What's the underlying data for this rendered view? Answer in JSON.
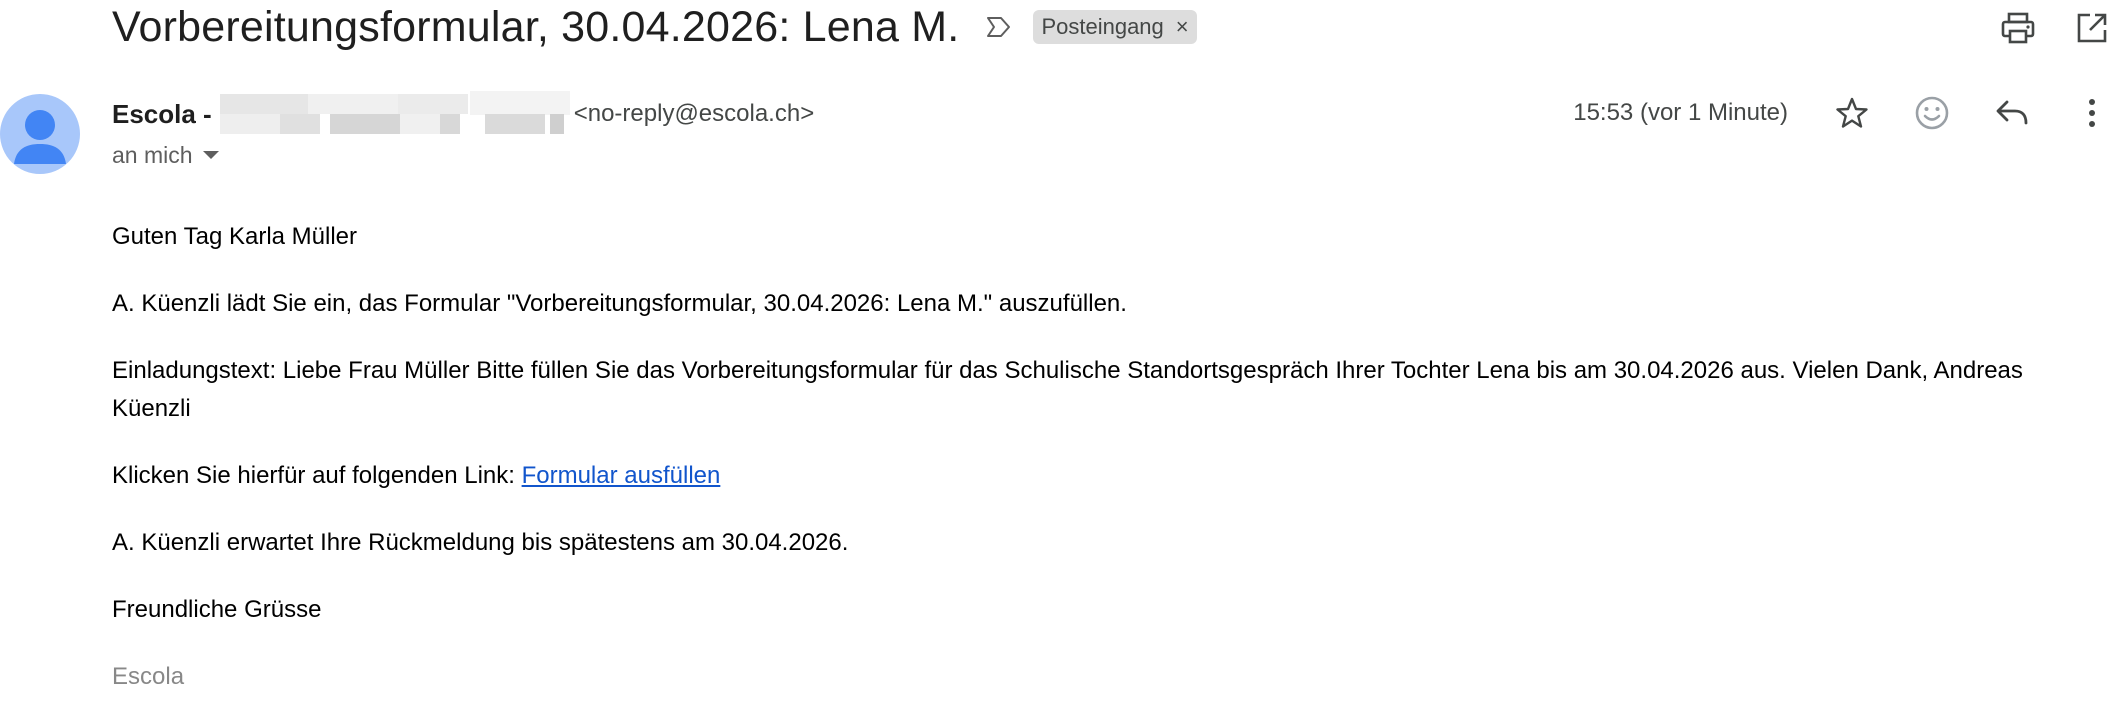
{
  "subject": "Vorbereitungsformular, 30.04.2026: Lena M.",
  "label_chip": "Posteingang",
  "label_remove": "×",
  "sender": {
    "name": "Escola -",
    "email": "<no-reply@escola.ch>"
  },
  "recipient": "an mich",
  "time": "15:53 (vor 1 Minute)",
  "body": {
    "greeting": "Guten Tag Karla Müller",
    "line1": "A. Küenzli lädt Sie ein, das Formular \"Vorbereitungsformular, 30.04.2026: Lena M.\" auszufüllen.",
    "invitation": "Einladungstext: Liebe Frau Müller Bitte füllen Sie das Vorbereitungsformular für das Schulische Standortsgespräch Ihrer Tochter Lena bis am 30.04.2026 aus. Vielen Dank, Andreas Küenzli",
    "link_prefix": "Klicken Sie hierfür auf folgenden Link: ",
    "link_text": "Formular ausfüllen",
    "deadline": "A. Küenzli erwartet Ihre Rückmeldung bis spätestens am 30.04.2026.",
    "closing": "Freundliche Grüsse",
    "signature": "Escola"
  },
  "icons": [
    "label-icon",
    "print-icon",
    "open-in-new-window-icon",
    "star-icon",
    "emoji-icon",
    "reply-icon",
    "more-vert-icon",
    "avatar-person-icon",
    "chevron-down-icon"
  ]
}
